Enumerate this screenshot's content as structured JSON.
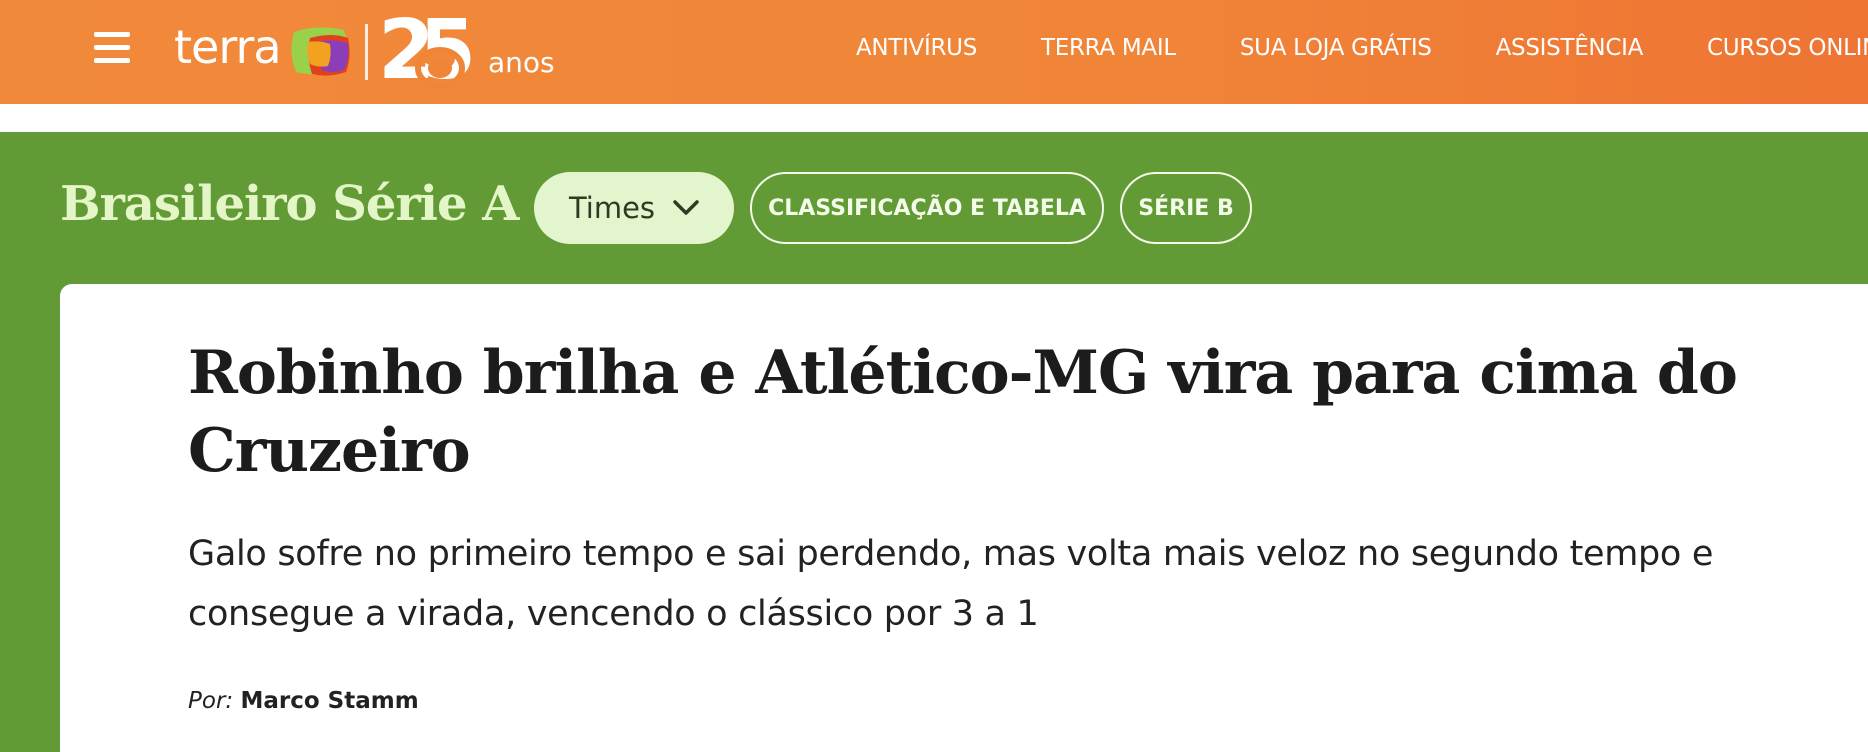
{
  "header": {
    "logo_word": "terra",
    "logo_anniversary": "25",
    "logo_anos": "anos",
    "nav": [
      {
        "label": "ANTIVÍRUS"
      },
      {
        "label": "TERRA MAIL"
      },
      {
        "label": "SUA LOJA GRÁTIS"
      },
      {
        "label": "ASSISTÊNCIA"
      },
      {
        "label": "CURSOS ONLINE"
      }
    ],
    "colors": {
      "background": "#f0853a",
      "text": "#ffffff"
    }
  },
  "section": {
    "title": "Brasileiro Série A",
    "times_label": "Times",
    "classificacao_label": "CLASSIFICAÇÃO E TABELA",
    "serie_b_label": "SÉRIE B",
    "colors": {
      "background": "#629a36",
      "title": "#e4f5c8",
      "pill": "#e3f5cc"
    }
  },
  "article": {
    "headline": "Robinho brilha e Atlético-MG vira para cima do Cruzeiro",
    "subtitle": "Galo sofre no primeiro tempo e sai perdendo, mas volta mais veloz no segundo tempo e consegue a virada, vencendo o clássico por 3 a 1",
    "byline_prefix": "Por:",
    "author": "Marco Stamm"
  },
  "icons": {
    "menu": "hamburger-menu-icon",
    "times_dropdown": "chevron-down-icon"
  }
}
